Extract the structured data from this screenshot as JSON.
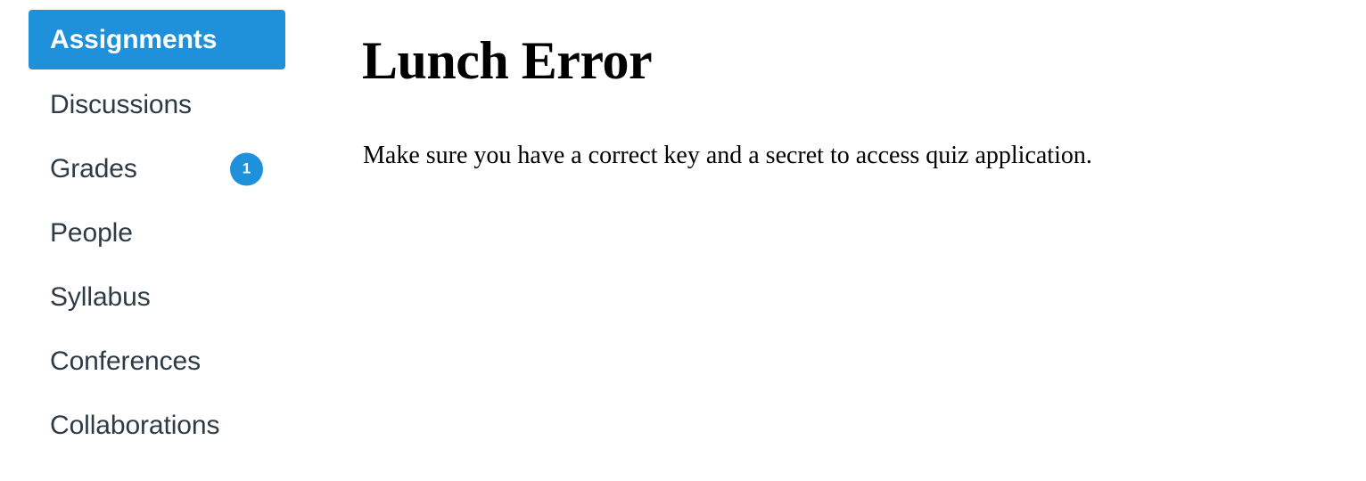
{
  "theme": {
    "accent_blue": "#1f91db",
    "text_dark": "#2d3b45",
    "text_black": "#000000",
    "background": "#ffffff",
    "active_label": "#ffffff"
  },
  "sidebar": {
    "items": [
      {
        "label": "Assignments",
        "active": true,
        "badge": null
      },
      {
        "label": "Discussions",
        "active": false,
        "badge": null
      },
      {
        "label": "Grades",
        "active": false,
        "badge": "1"
      },
      {
        "label": "People",
        "active": false,
        "badge": null
      },
      {
        "label": "Syllabus",
        "active": false,
        "badge": null
      },
      {
        "label": "Conferences",
        "active": false,
        "badge": null
      },
      {
        "label": "Collaborations",
        "active": false,
        "badge": null
      }
    ]
  },
  "main": {
    "title": "Lunch Error",
    "body": "Make sure you have a correct key and a secret to access quiz application."
  }
}
